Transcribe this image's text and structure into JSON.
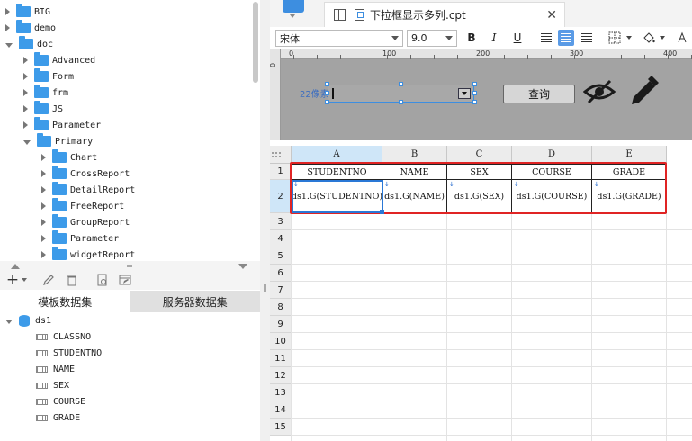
{
  "left_panel": {
    "tree": [
      {
        "label": "BIG",
        "depth": 0,
        "expanded": false
      },
      {
        "label": "demo",
        "depth": 0,
        "expanded": false
      },
      {
        "label": "doc",
        "depth": 0,
        "expanded": true
      },
      {
        "label": "Advanced",
        "depth": 1,
        "expanded": false
      },
      {
        "label": "Form",
        "depth": 1,
        "expanded": false
      },
      {
        "label": "frm",
        "depth": 1,
        "expanded": false
      },
      {
        "label": "JS",
        "depth": 1,
        "expanded": false
      },
      {
        "label": "Parameter",
        "depth": 1,
        "expanded": false
      },
      {
        "label": "Primary",
        "depth": 1,
        "expanded": true
      },
      {
        "label": "Chart",
        "depth": 2,
        "expanded": false
      },
      {
        "label": "CrossReport",
        "depth": 2,
        "expanded": false
      },
      {
        "label": "DetailReport",
        "depth": 2,
        "expanded": false
      },
      {
        "label": "FreeReport",
        "depth": 2,
        "expanded": false
      },
      {
        "label": "GroupReport",
        "depth": 2,
        "expanded": false
      },
      {
        "label": "Parameter",
        "depth": 2,
        "expanded": false
      },
      {
        "label": "widgetReport",
        "depth": 2,
        "expanded": false
      }
    ],
    "dataset_tabs": {
      "template": "模板数据集",
      "server": "服务器数据集"
    },
    "dataset": {
      "name": "ds1",
      "fields": [
        "CLASSNO",
        "STUDENTNO",
        "NAME",
        "SEX",
        "COURSE",
        "GRADE"
      ]
    },
    "toolbar_icons": [
      "add-icon",
      "edit-icon",
      "delete-icon",
      "preview-icon",
      "edit-dataset-icon"
    ]
  },
  "document_tab": {
    "title": "下拉框显示多列.cpt"
  },
  "format_toolbar": {
    "font_family": "宋体",
    "font_size": "9.0",
    "bold": "B",
    "italic": "I",
    "underline": "U",
    "active_align": "center"
  },
  "parameter_pane": {
    "ruler_labels": [
      "0",
      "100",
      "200",
      "300",
      "400"
    ],
    "ruler_left_label": "0",
    "widget_label": "22像素",
    "query_button": "查询",
    "colors": {
      "pane_bg": "#a3a3a3",
      "selection": "#3d8ee0"
    }
  },
  "grid": {
    "columns": [
      "A",
      "B",
      "C",
      "D",
      "E"
    ],
    "rows": [
      "1",
      "2",
      "3",
      "4",
      "5",
      "6",
      "7",
      "8",
      "9",
      "10",
      "11",
      "12",
      "13",
      "14",
      "15"
    ],
    "header_row": [
      "STUDENTNO",
      "NAME",
      "SEX",
      "COURSE",
      "GRADE"
    ],
    "data_row": [
      "ds1.G(STUDENTNO)",
      "ds1.G(NAME)",
      "ds1.G(SEX)",
      "ds1.G(COURSE)",
      "ds1.G(GRADE)"
    ],
    "selected_cell": "A2",
    "highlight_color": "#e02424"
  }
}
